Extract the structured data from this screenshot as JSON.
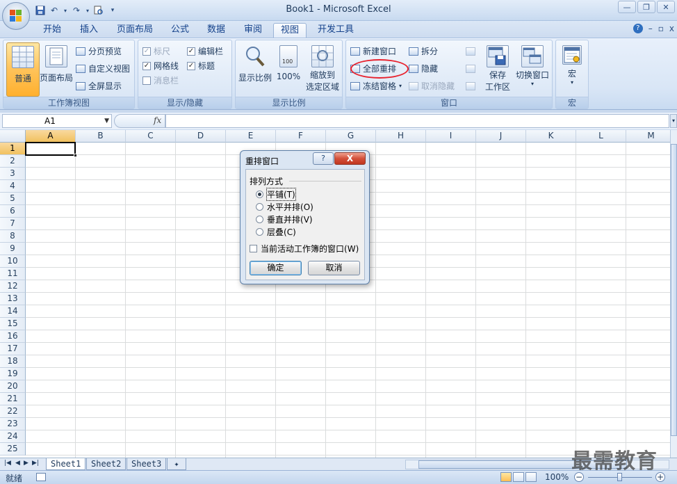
{
  "window": {
    "title": "Book1 - Microsoft Excel",
    "controls": [
      "minimize",
      "restore",
      "close"
    ]
  },
  "quick_access": [
    "save-icon",
    "undo-icon",
    "redo-icon",
    "print-preview-icon",
    "customize-icon"
  ],
  "tabs": [
    {
      "label": "开始"
    },
    {
      "label": "插入"
    },
    {
      "label": "页面布局"
    },
    {
      "label": "公式"
    },
    {
      "label": "数据"
    },
    {
      "label": "审阅"
    },
    {
      "label": "视图",
      "active": true
    },
    {
      "label": "开发工具"
    }
  ],
  "ribbon": {
    "workbook_views": {
      "label": "工作簿视图",
      "normal": "普通",
      "page_layout": "页面布局",
      "page_break": "分页预览",
      "custom_views": "自定义视图",
      "full_screen": "全屏显示"
    },
    "show_hide": {
      "label": "显示/隐藏",
      "ruler": "标尺",
      "formula_bar": "编辑栏",
      "gridlines": "网格线",
      "headings": "标题",
      "message_bar": "消息栏"
    },
    "zoom": {
      "label": "显示比例",
      "zoom": "显示比例",
      "hundred": "100%",
      "to_selection_1": "缩放到",
      "to_selection_2": "选定区域"
    },
    "window": {
      "label": "窗口",
      "new_window": "新建窗口",
      "arrange_all": "全部重排",
      "freeze_panes": "冻结窗格",
      "split": "拆分",
      "hide": "隐藏",
      "unhide": "取消隐藏",
      "save_workspace_1": "保存",
      "save_workspace_2": "工作区",
      "switch_windows": "切换窗口"
    },
    "macros": {
      "label": "宏",
      "macros": "宏"
    }
  },
  "formula_bar": {
    "name_box": "A1",
    "fx": "fx",
    "value": ""
  },
  "grid": {
    "columns": [
      "A",
      "B",
      "C",
      "D",
      "E",
      "F",
      "G",
      "H",
      "I",
      "J",
      "K",
      "L",
      "M"
    ],
    "rows": [
      "1",
      "2",
      "3",
      "4",
      "5",
      "6",
      "7",
      "8",
      "9",
      "10",
      "11",
      "12",
      "13",
      "14",
      "15",
      "16",
      "17",
      "18",
      "19",
      "20",
      "21",
      "22",
      "23",
      "24",
      "25"
    ],
    "selected_cell": "A1"
  },
  "sheets": [
    {
      "name": "Sheet1",
      "active": true
    },
    {
      "name": "Sheet2"
    },
    {
      "name": "Sheet3"
    }
  ],
  "status": {
    "text": "就绪",
    "zoom": "100%"
  },
  "dialog": {
    "title": "重排窗口",
    "help": "?",
    "close": "X",
    "section": "排列方式",
    "options": [
      {
        "label": "平铺",
        "key": "(T)",
        "selected": true
      },
      {
        "label": "水平并排",
        "key": "(O)"
      },
      {
        "label": "垂直并排",
        "key": "(V)"
      },
      {
        "label": "层叠",
        "key": "(C)"
      }
    ],
    "checkbox": "当前活动工作簿的窗口",
    "checkbox_key": "(W)",
    "ok": "确定",
    "cancel": "取消"
  },
  "watermark": "最需教育",
  "colors": {
    "accent": "#ffc35a",
    "annotation": "#e8232f",
    "ribbon_text": "#15428b"
  }
}
